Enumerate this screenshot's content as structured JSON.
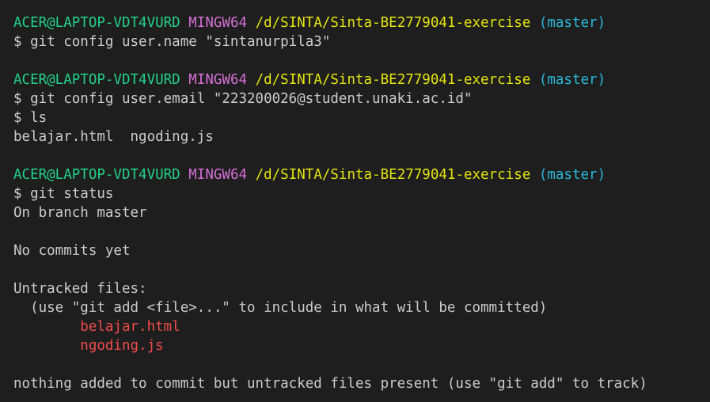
{
  "colors": {
    "background": "#1e1e1e",
    "user_host": "#23d18b",
    "msystem": "#d670d6",
    "path": "#e5e510",
    "branch": "#29b8db",
    "untracked": "#f14c4c",
    "text": "#cccccc"
  },
  "blocks": [
    {
      "prompt": {
        "user_host": "ACER@LAPTOP-VDT4VURD",
        "msystem": "MINGW64",
        "path": "/d/SINTA/Sinta-BE2779041-exercise",
        "branch": "(master)"
      },
      "command": "$ git config user.name \"sintanurpila3\"",
      "output": []
    },
    {
      "prompt": {
        "user_host": "ACER@LAPTOP-VDT4VURD",
        "msystem": "MINGW64",
        "path": "/d/SINTA/Sinta-BE2779041-exercise",
        "branch": "(master)"
      },
      "command": "$ git config user.email \"223200026@student.unaki.ac.id\"",
      "command2": "$ ls",
      "output": [
        "belajar.html  ngoding.js"
      ]
    },
    {
      "prompt": {
        "user_host": "ACER@LAPTOP-VDT4VURD",
        "msystem": "MINGW64",
        "path": "/d/SINTA/Sinta-BE2779041-exercise",
        "branch": "(master)"
      },
      "command": "$ git status",
      "output": {
        "branch_line": "On branch master",
        "commits_line": "No commits yet",
        "untracked_header": "Untracked files:",
        "untracked_hint": "  (use \"git add <file>...\" to include in what will be committed)",
        "untracked_files": [
          "        belajar.html",
          "        ngoding.js"
        ],
        "footer": "nothing added to commit but untracked files present (use \"git add\" to track)"
      }
    }
  ]
}
